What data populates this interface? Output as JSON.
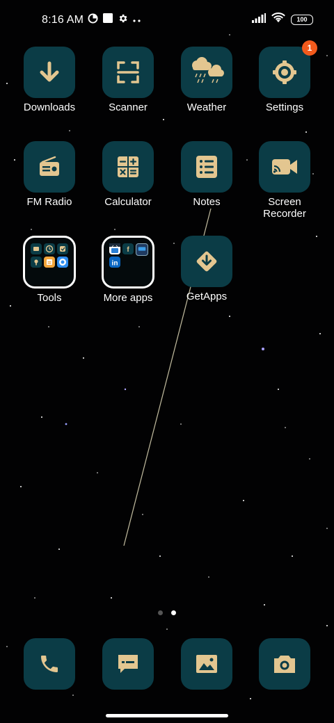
{
  "status_bar": {
    "time": "8:16 AM",
    "battery": "100",
    "icons": [
      "data-saver-icon",
      "square-notification-icon",
      "gear-icon",
      "more-dots-icon",
      "signal-icon",
      "wifi-icon",
      "battery-icon"
    ]
  },
  "apps": [
    {
      "label": "Downloads",
      "icon": "download-arrow-icon"
    },
    {
      "label": "Scanner",
      "icon": "scanner-icon"
    },
    {
      "label": "Weather",
      "icon": "weather-cloud-icon"
    },
    {
      "label": "Settings",
      "icon": "gear-icon",
      "badge": "1"
    },
    {
      "label": "FM Radio",
      "icon": "radio-icon"
    },
    {
      "label": "Calculator",
      "icon": "calculator-icon"
    },
    {
      "label": "Notes",
      "icon": "notes-list-icon"
    },
    {
      "label": "Screen\nRecorder",
      "icon": "video-camera-icon"
    },
    {
      "label": "Tools",
      "icon": "folder"
    },
    {
      "label": "More apps",
      "icon": "folder"
    },
    {
      "label": "GetApps",
      "icon": "getapps-icon"
    }
  ],
  "more_apps_mini_labels": [
    "amazon",
    "f",
    "prime video",
    "in"
  ],
  "dock": [
    {
      "name": "phone",
      "icon": "phone-icon"
    },
    {
      "name": "messages",
      "icon": "message-icon"
    },
    {
      "name": "gallery",
      "icon": "gallery-icon"
    },
    {
      "name": "camera",
      "icon": "camera-icon"
    }
  ],
  "page_indicator": {
    "pages": 2,
    "current": 2
  },
  "colors": {
    "icon_bg": "#0b3c46",
    "glyph": "#e3c690",
    "badge": "#f25a1c"
  }
}
